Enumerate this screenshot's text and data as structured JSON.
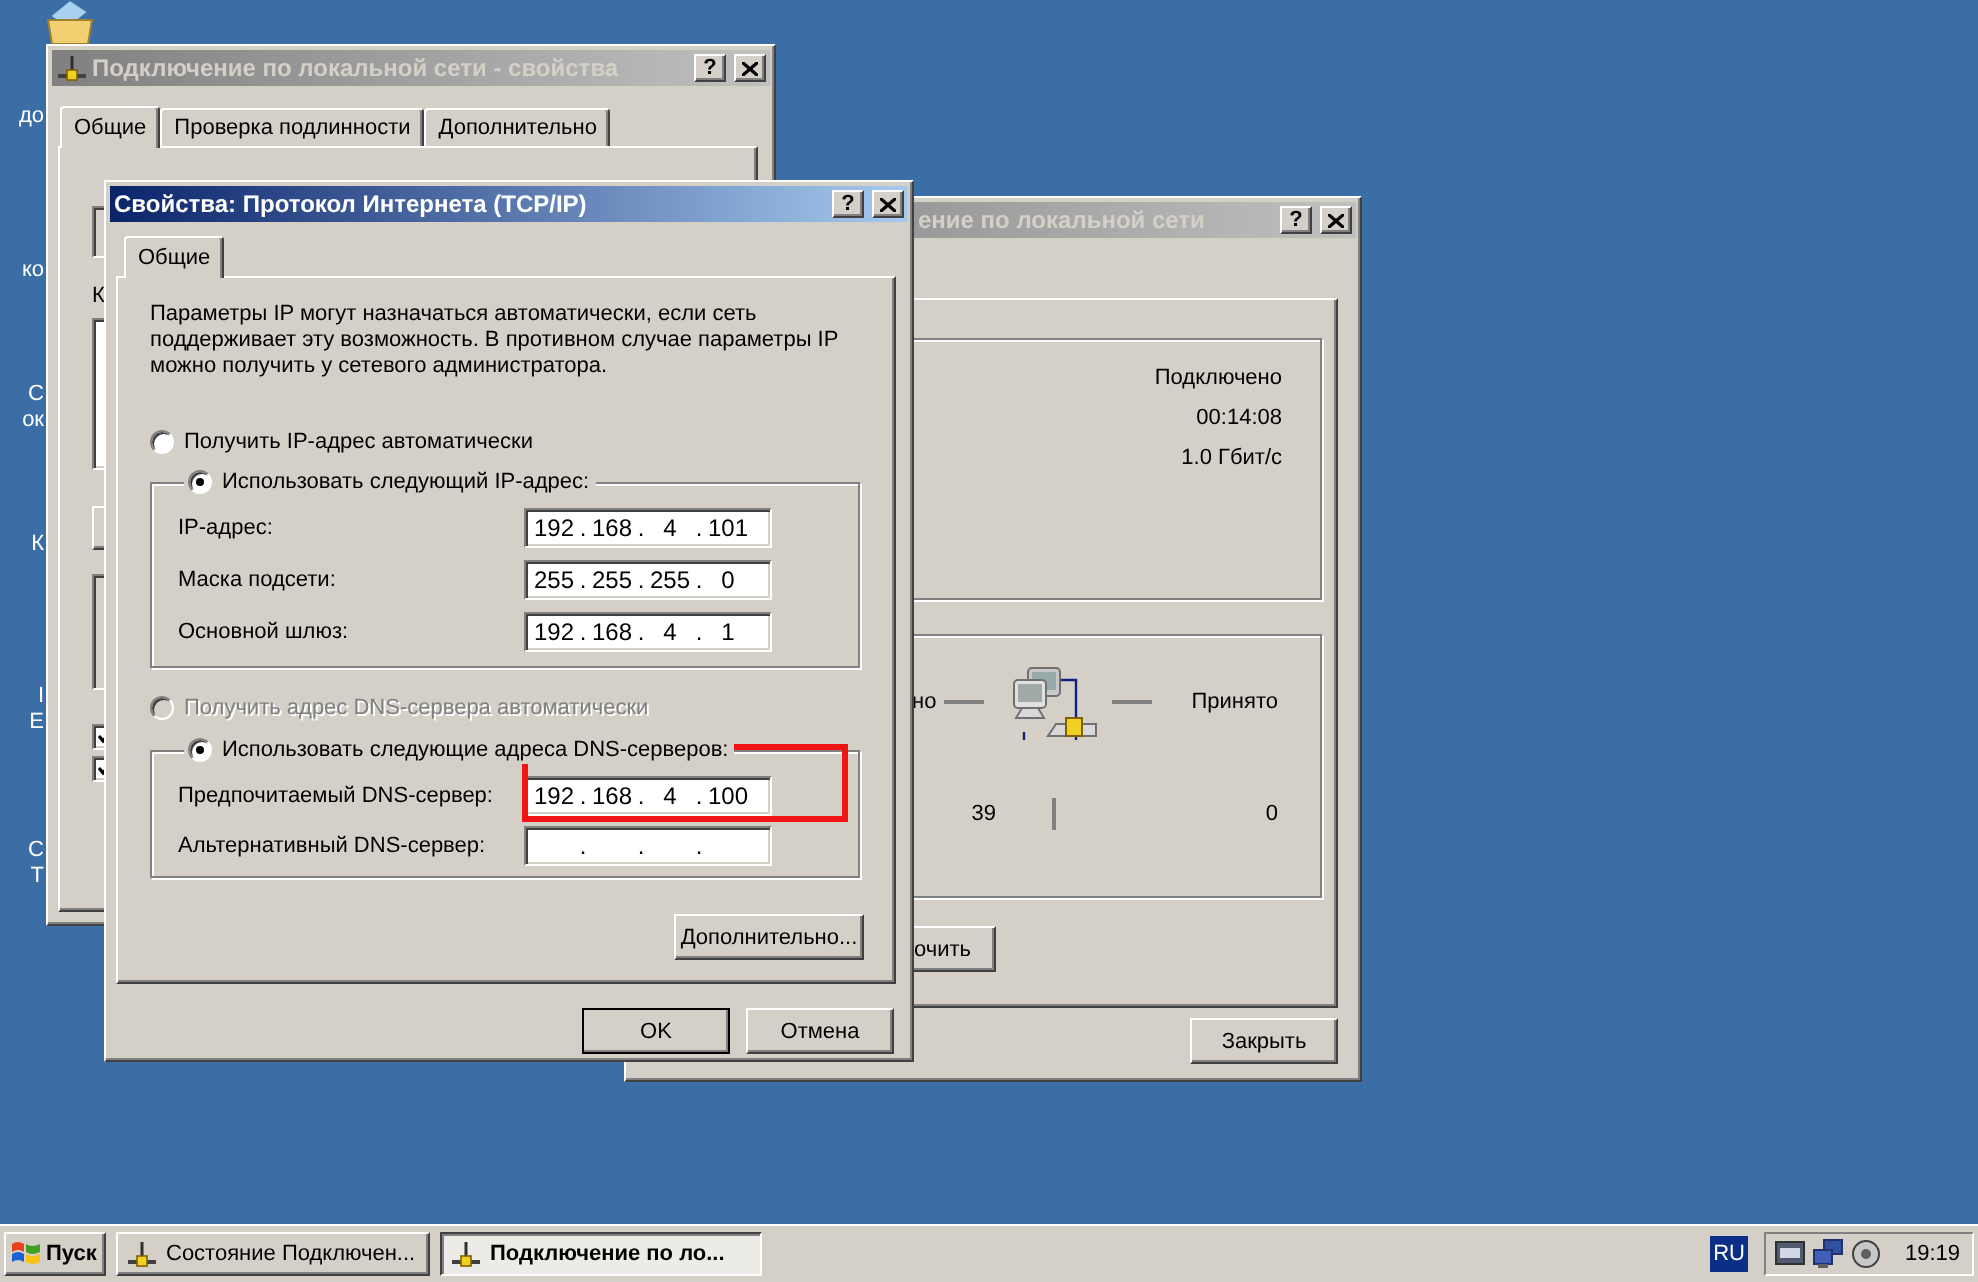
{
  "desktop": {
    "icon_labels": [
      {
        "lines": [
          "до"
        ]
      },
      {
        "lines": [
          "ко"
        ]
      },
      {
        "lines": [
          "С",
          "ок"
        ]
      },
      {
        "lines": [
          "К"
        ]
      },
      {
        "lines": [
          "I",
          "E"
        ]
      },
      {
        "lines": [
          "С",
          "Т"
        ]
      }
    ]
  },
  "lan_properties_window": {
    "title": "Подключение по локальной сети - свойства",
    "active": false,
    "help_button": "?",
    "tabs": [
      {
        "label": "Общие",
        "selected": true
      },
      {
        "label": "Проверка подлинности",
        "selected": false
      },
      {
        "label": "Дополнительно",
        "selected": false
      }
    ],
    "group_label_fragment": "К",
    "checkboxes": [
      {
        "checked": true
      },
      {
        "checked": true
      }
    ]
  },
  "status_window": {
    "title": "ение по локальной сети",
    "active": false,
    "help_button": "?",
    "details": [
      "Подключено",
      "00:14:08",
      "1.0 Гбит/с"
    ],
    "activity": {
      "sent_label": "но",
      "received_label": "Принято",
      "sent": "39",
      "received": "0"
    },
    "buttons": [
      "очить",
      "Закрыть"
    ]
  },
  "tcpip_window": {
    "title": "Свойства: Протокол Интернета (TCP/IP)",
    "active": true,
    "help_button": "?",
    "tabs": [
      {
        "label": "Общие",
        "selected": true
      }
    ],
    "description": "Параметры IP могут назначаться автоматически, если сеть поддерживает эту возможность. В противном случае параметры IP можно получить у сетевого администратора.",
    "separator": ".",
    "ip_options": [
      {
        "label": "Получить IP-адрес автоматически",
        "selected": false,
        "disabled": false
      },
      {
        "label": "Использовать следующий IP-адрес:",
        "selected": true,
        "disabled": false
      }
    ],
    "ip_fields": [
      {
        "label": "IP-адрес:",
        "octets": [
          "192",
          "168",
          "4",
          "101"
        ],
        "highlighted": false
      },
      {
        "label": "Маска подсети:",
        "octets": [
          "255",
          "255",
          "255",
          "0"
        ],
        "highlighted": false
      },
      {
        "label": "Основной шлюз:",
        "octets": [
          "192",
          "168",
          "4",
          "1"
        ],
        "highlighted": false
      }
    ],
    "dns_options": [
      {
        "label": "Получить адрес DNS-сервера автоматически",
        "selected": false,
        "disabled": true
      },
      {
        "label": "Использовать следующие адреса DNS-серверов:",
        "selected": true,
        "disabled": false
      }
    ],
    "dns_fields": [
      {
        "label": "Предпочитаемый DNS-сервер:",
        "octets": [
          "192",
          "168",
          "4",
          "100"
        ],
        "highlighted": true
      },
      {
        "label": "Альтернативный DNS-сервер:",
        "highlighted": false
      }
    ],
    "advanced_button": "Дополнительно...",
    "buttons": [
      {
        "label": "OK",
        "default": true
      },
      {
        "label": "Отмена",
        "default": false
      }
    ]
  },
  "taskbar": {
    "start_button": "Пуск",
    "tasks": [
      {
        "label": "Состояние Подключен...",
        "selected": false
      },
      {
        "label": "Подключение по ло...",
        "selected": true
      }
    ],
    "language": "RU",
    "clock": "19:19"
  }
}
